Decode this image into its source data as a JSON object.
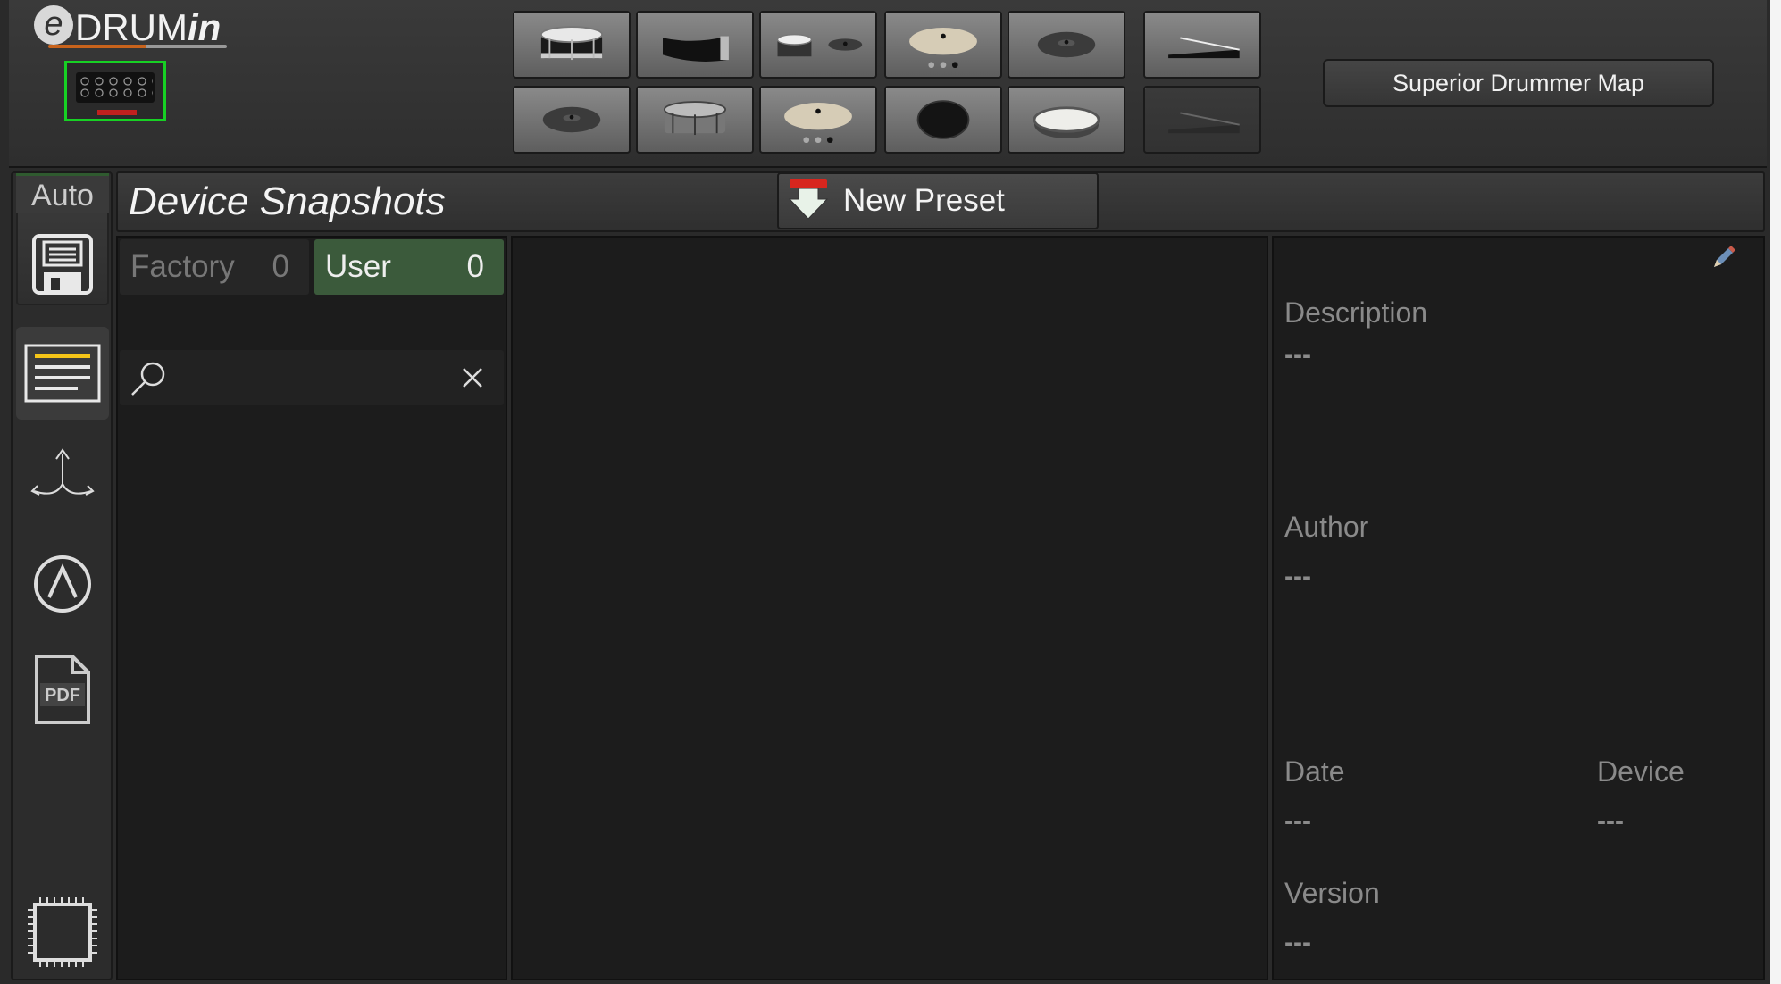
{
  "logo": {
    "prefix": "e",
    "main": "DRUM",
    "suffix": "in"
  },
  "superior_map_label": "Superior Drummer Map",
  "sidebar": {
    "auto_label": "Auto",
    "pdf_label": "PDF"
  },
  "page_title": "Device Snapshots",
  "new_preset_label": "New Preset",
  "tabs": {
    "factory": {
      "label": "Factory",
      "count": "0"
    },
    "user": {
      "label": "User",
      "count": "0"
    }
  },
  "search": {
    "value": "",
    "placeholder": ""
  },
  "info": {
    "description_label": "Description",
    "description_value": "---",
    "author_label": "Author",
    "author_value": "---",
    "date_label": "Date",
    "date_value": "---",
    "device_label": "Device",
    "device_value": "---",
    "version_label": "Version",
    "version_value": "---"
  },
  "icons": {
    "pads_row1": [
      "snare-drum-icon",
      "rim-pad-icon",
      "tom-and-cymbal-icon",
      "crash-cymbal-3zone-icon",
      "ride-cymbal-icon",
      "hihat-pedal-icon"
    ],
    "pads_row2": [
      "cymbal-icon",
      "drum-shell-icon",
      "cymbal-3zone-icon",
      "mesh-pad-icon",
      "kick-pad-icon",
      "pedal-dim-icon"
    ]
  },
  "colors": {
    "device_active": "#17d124",
    "user_tab": "#3b5a3b",
    "accent_yellow": "#f5c518"
  }
}
